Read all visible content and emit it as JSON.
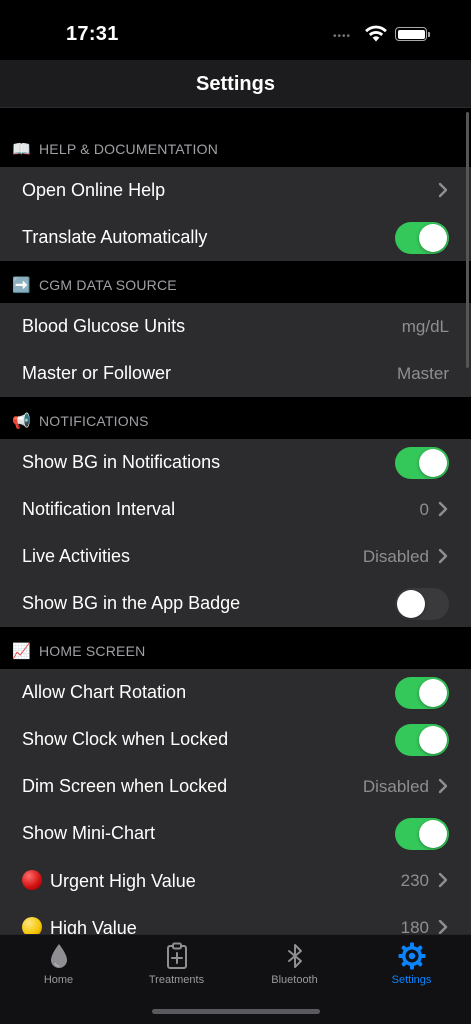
{
  "status": {
    "time": "17:31",
    "dots": "••••"
  },
  "nav": {
    "title": "Settings"
  },
  "sections": {
    "help": {
      "icon": "📖",
      "label": "HELP & DOCUMENTATION",
      "rows": {
        "online_help": "Open Online Help",
        "translate": "Translate Automatically"
      },
      "translate_on": true
    },
    "cgm": {
      "icon": "➡️",
      "label": "CGM DATA SOURCE",
      "rows": {
        "units": "Blood Glucose Units",
        "units_value": "mg/dL",
        "master": "Master or Follower",
        "master_value": "Master"
      }
    },
    "notifications": {
      "icon": "📢",
      "label": "NOTIFICATIONS",
      "rows": {
        "show_bg": "Show BG in Notifications",
        "interval": "Notification Interval",
        "interval_value": "0",
        "live": "Live Activities",
        "live_value": "Disabled",
        "badge": "Show BG in the App Badge"
      },
      "show_bg_on": true,
      "badge_on": false
    },
    "home": {
      "icon": "📈",
      "label": "HOME SCREEN",
      "rows": {
        "rotation": "Allow Chart Rotation",
        "clock": "Show Clock when Locked",
        "dim": "Dim Screen when Locked",
        "dim_value": "Disabled",
        "mini_chart": "Show Mini-Chart",
        "urgent_high": "Urgent High Value",
        "urgent_high_value": "230",
        "high": "High Value",
        "high_value": "180"
      },
      "rotation_on": true,
      "clock_on": true,
      "mini_chart_on": true
    }
  },
  "tabs": [
    {
      "label": "Home",
      "icon": "drop-icon"
    },
    {
      "label": "Treatments",
      "icon": "clipboard-plus-icon"
    },
    {
      "label": "Bluetooth",
      "icon": "bluetooth-icon"
    },
    {
      "label": "Settings",
      "icon": "gear-icon",
      "active": true
    }
  ],
  "colors": {
    "toggle_on": "#34c759",
    "accent": "#0a84ff",
    "urgent_high_dot": "#e11d1d",
    "high_dot": "#f5c400"
  }
}
